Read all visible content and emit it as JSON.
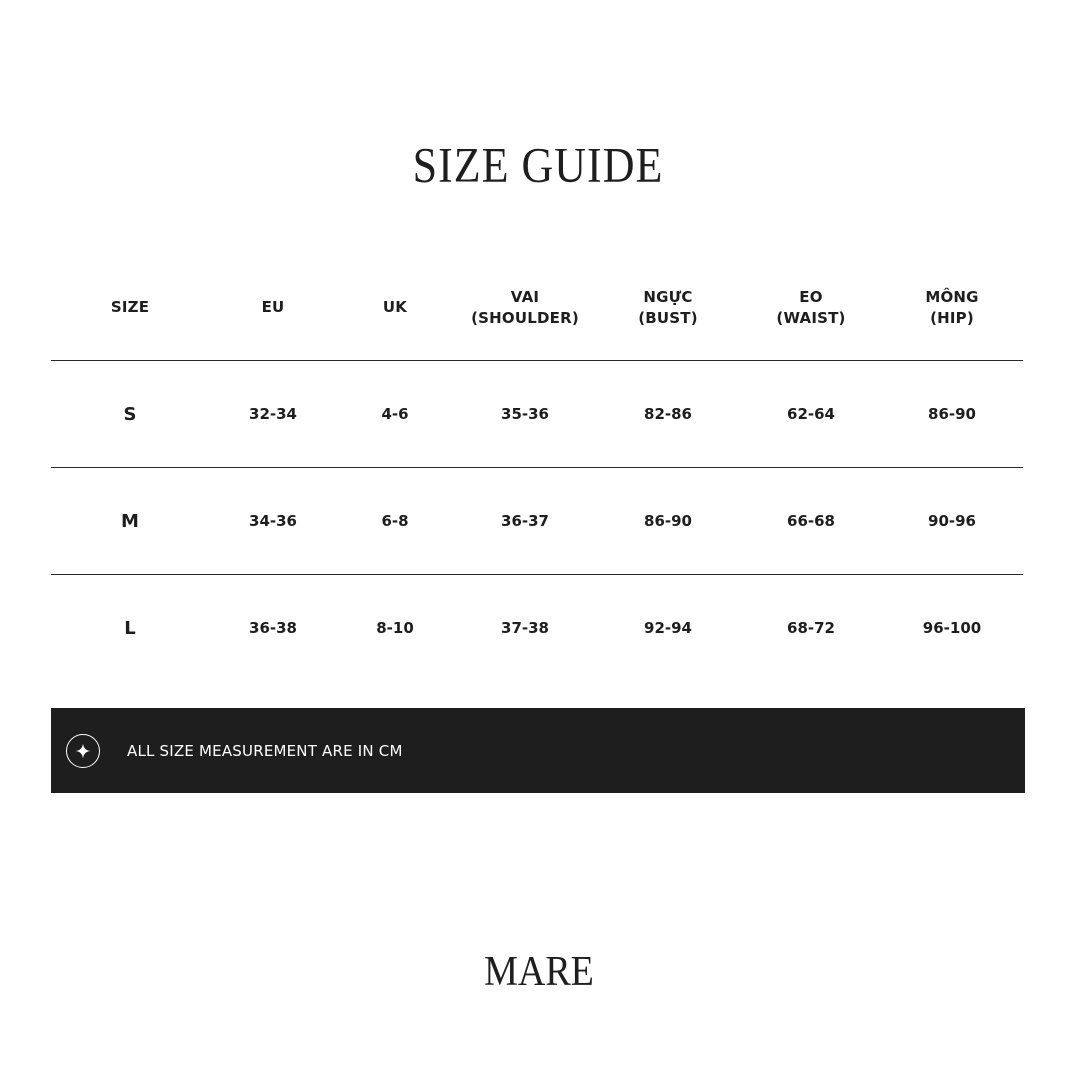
{
  "title": "SIZE GUIDE",
  "table": {
    "headers": [
      [
        "SIZE"
      ],
      [
        "EU"
      ],
      [
        "UK"
      ],
      [
        "VAI",
        "(SHOULDER)"
      ],
      [
        "NGỰC",
        "(BUST)"
      ],
      [
        "EO",
        "(WAIST)"
      ],
      [
        "MÔNG",
        "(HIP)"
      ]
    ],
    "rows": [
      [
        "S",
        "32-34",
        "4-6",
        "35-36",
        "82-86",
        "62-64",
        "86-90"
      ],
      [
        "M",
        "34-36",
        "6-8",
        "36-37",
        "86-90",
        "66-68",
        "90-96"
      ],
      [
        "L",
        "36-38",
        "8-10",
        "37-38",
        "92-94",
        "68-72",
        "96-100"
      ]
    ]
  },
  "note": {
    "icon": "sparkle-icon",
    "text": "ALL SIZE MEASUREMENT ARE IN CM"
  },
  "brand": "MARE",
  "colors": {
    "text": "#1e1e1e",
    "bar_background": "#1e1e1e",
    "bar_text": "#ffffff",
    "background": "#ffffff"
  }
}
